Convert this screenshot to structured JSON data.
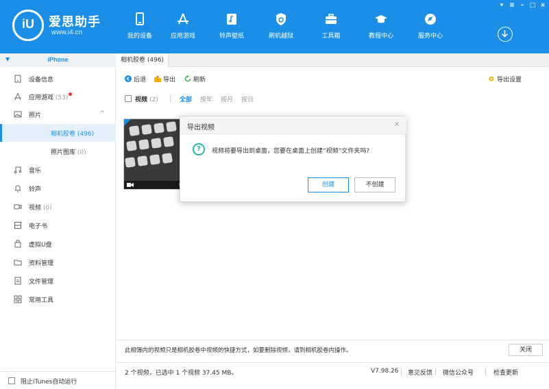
{
  "app": {
    "logo_mark": "iU",
    "title": "爱思助手",
    "url": "www.i4.cn"
  },
  "nav": [
    {
      "label": "我的设备",
      "icon": "phone-icon"
    },
    {
      "label": "应用游戏",
      "icon": "app-store-icon"
    },
    {
      "label": "铃声壁纸",
      "icon": "music-note-icon"
    },
    {
      "label": "刷机越狱",
      "icon": "shield-icon"
    },
    {
      "label": "工具箱",
      "icon": "toolbox-icon"
    },
    {
      "label": "教程中心",
      "icon": "graduation-cap-icon"
    },
    {
      "label": "服务中心",
      "icon": "compass-icon"
    }
  ],
  "sidebar": {
    "device": "iPhone",
    "items": [
      {
        "label": "设备信息",
        "icon": "device-info-icon"
      },
      {
        "label": "应用游戏",
        "count": "(53)",
        "icon": "apps-icon",
        "badge": true
      },
      {
        "label": "照片",
        "icon": "photo-icon",
        "expanded": true
      },
      {
        "label": "相机胶卷",
        "count": "(496)",
        "active": true
      },
      {
        "label": "照片图库",
        "count": "(0)"
      },
      {
        "label": "音乐",
        "icon": "music-icon"
      },
      {
        "label": "铃声",
        "icon": "bell-icon"
      },
      {
        "label": "视频",
        "count": "(0)",
        "icon": "video-icon"
      },
      {
        "label": "电子书",
        "icon": "ebook-icon"
      },
      {
        "label": "虚拟U盘",
        "icon": "usb-drive-icon"
      },
      {
        "label": "资料管理",
        "icon": "folder-icon"
      },
      {
        "label": "文件管理",
        "icon": "file-icon"
      },
      {
        "label": "常用工具",
        "icon": "grid-icon"
      }
    ],
    "bottom_checkbox": "阻止iTunes自动运行"
  },
  "main": {
    "tab": "相机胶卷 (496)",
    "toolbar": {
      "back": "后退",
      "export": "导出",
      "refresh": "刷新",
      "export_settings": "导出设置"
    },
    "filter": {
      "label": "视频",
      "count": "(2)",
      "chips": [
        "全部",
        "按年",
        "按月",
        "按日"
      ],
      "active": "全部"
    },
    "thumb_duration": "0",
    "footer_note": "此相簿内的视频只是相机胶卷中视频的快捷方式，如要删除视频，请到相机胶卷内操作。",
    "close_button": "关闭"
  },
  "statusbar": {
    "selection": "2 个视频，已选中 1 个视频 37.45 MB。",
    "version": "V7.98.26",
    "feedback": "意见反馈",
    "wechat": "微信公众号",
    "update": "检查更新"
  },
  "dialog": {
    "title": "导出视频",
    "close": "×",
    "message": "视频将要导出到桌面，您要在桌面上创建“视频”文件夹吗?",
    "confirm": "创建",
    "cancel": "不创建"
  },
  "colors": {
    "brand": "#1b8fe8",
    "dialog_icon": "#23b8a6",
    "badge": "#e33333"
  }
}
